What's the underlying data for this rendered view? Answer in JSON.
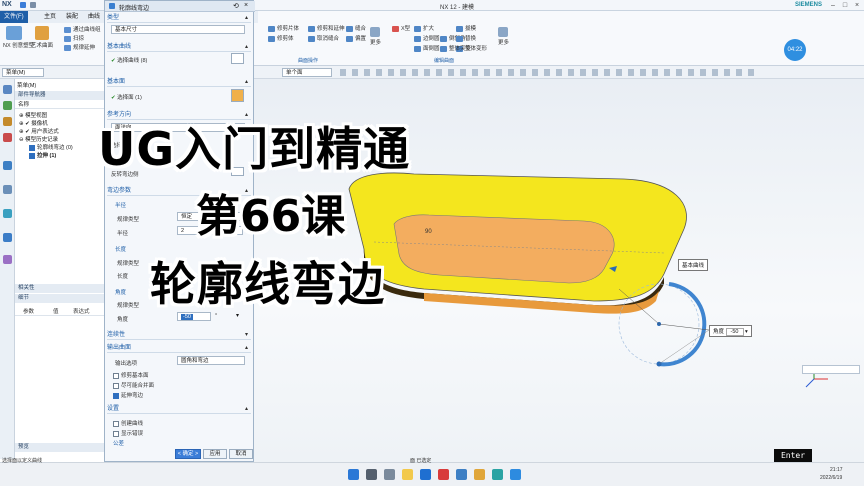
{
  "titlebar": {
    "app": "NX",
    "title": "NX 12 - 建模",
    "brand": "SIEMENS"
  },
  "tabs": [
    {
      "label": "文件(F)"
    },
    {
      "label": "主页"
    },
    {
      "label": "装配"
    },
    {
      "label": "曲线"
    }
  ],
  "ribbon_left": {
    "items": [
      "NX 创意塑型",
      "艺术曲面",
      "通过曲线组",
      "扫掠",
      "规律延伸"
    ]
  },
  "ribbon_right": {
    "items": [
      "修剪片体",
      "修剪和延伸",
      "缝合",
      "修剪体",
      "取消缝合",
      "偏置",
      "X型",
      "扩大",
      "边倒圆",
      "面倒圆",
      "倒斜角",
      "拔模",
      "替换",
      "整体变形",
      "整体突变",
      "变换",
      "U/V向"
    ],
    "groups": [
      "曲面操作",
      "编辑曲面"
    ],
    "more": "更多"
  },
  "toolbar": {
    "filter": "单个面",
    "clock": "04:22"
  },
  "nav": {
    "filter_label": "菜单(M)",
    "header": "部件导航器",
    "title_col": "名称",
    "rows": [
      "模型视图",
      "摄像机",
      "用户表达式",
      "模型历史记录",
      "轮廓线弯边 (0)",
      "拉伸 (1)"
    ],
    "dep_header": "相关性",
    "detail_header": "细节",
    "col_param": "参数",
    "col_value": "值",
    "col_expr": "表达式",
    "preview": "预览"
  },
  "dialog": {
    "title": "轮廓线弯边",
    "type_label": "类型",
    "type_value": "基本尺寸",
    "base_curve_label": "基本曲线",
    "base_curve_select": "选择曲线 (8)",
    "base_face_label": "基本面",
    "base_face_select": "选择面 (1)",
    "ref_dir_label": "参考方向",
    "ref_dir_value": "面法向",
    "select_label": "选择",
    "reverse_label": "反转弯边侧",
    "flange_params": "弯边参数",
    "radius_hdr": "半径",
    "law_type": "规律类型",
    "law_value": "恒定",
    "radius_label": "半径",
    "radius_value": "2",
    "length_hdr": "长度",
    "length_law": "规律类型",
    "length_label": "长度",
    "angle_hdr": "角度",
    "angle_law": "规律类型",
    "angle_label": "角度",
    "angle_value": "-50",
    "angle_unit": "°",
    "continuity": "连续性",
    "output_hdr": "输出曲面",
    "output_option": "输出选项",
    "output_value": "圆角和弯边",
    "opt1": "修剪基本面",
    "opt2": "尽可能合并面",
    "opt3": "延伸弯边",
    "settings": "设置",
    "set1": "创建曲线",
    "set2": "显示错误",
    "tol": "公差",
    "ok": "< 确定 >",
    "apply": "应用",
    "cancel": "取消"
  },
  "viewport": {
    "callout1": "基本曲线",
    "angle_label": "角度",
    "angle_value": "-50",
    "dim_value": "90"
  },
  "overlay": {
    "line1": "UG入门到精通",
    "line2": "第66课",
    "line3": "轮廓线弯边"
  },
  "status": {
    "left": "选择面以定义曲线",
    "center": "面 已选定"
  },
  "taskbar": {
    "key": "Enter",
    "time": "21:17",
    "date": "2022/6/19"
  }
}
